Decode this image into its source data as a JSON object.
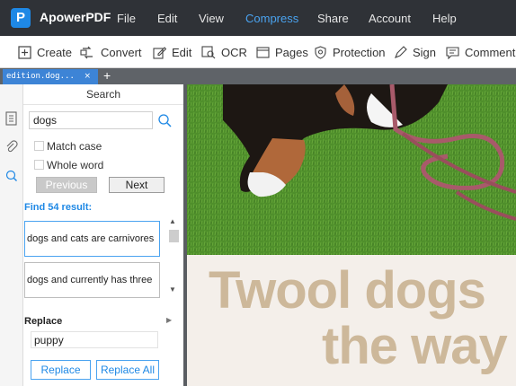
{
  "app": {
    "name": "ApowerPDF"
  },
  "menu": [
    "File",
    "Edit",
    "View",
    "Compress",
    "Share",
    "Account",
    "Help"
  ],
  "menu_active": "Compress",
  "toolbar": {
    "create": "Create",
    "convert": "Convert",
    "edit": "Edit",
    "ocr": "OCR",
    "pages": "Pages",
    "protection": "Protection",
    "sign": "Sign",
    "comment": "Comment"
  },
  "tabs": {
    "file_tab": "edition.dog...",
    "close": "×",
    "new_tab": "+"
  },
  "search_panel": {
    "title": "Search",
    "query": "dogs",
    "match_case": "Match case",
    "whole_word": "Whole word",
    "previous": "Previous",
    "next": "Next",
    "result_count": "Find 54 result:",
    "results": [
      "dogs and cats are carnivores",
      "dogs and currently has three"
    ],
    "replace_title": "Replace",
    "replace_value": "puppy",
    "replace_button": "Replace",
    "replace_all_button": "Replace All"
  },
  "document": {
    "line1": "Twool dogs",
    "line2": "the way"
  },
  "colors": {
    "menubar": "#2f3237",
    "accent": "#1e88e5",
    "tab_active": "#3d84d6",
    "doc_text": "#cdb89a"
  }
}
